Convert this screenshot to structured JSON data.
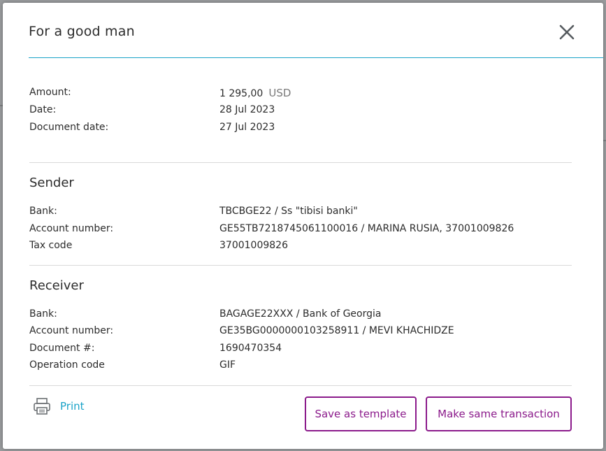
{
  "modal": {
    "title": "For a good man"
  },
  "summary": {
    "amount_label": "Amount:",
    "amount_value": "1 295,00",
    "amount_currency": "USD",
    "date_label": "Date:",
    "date_value": "28 Jul 2023",
    "document_date_label": "Document date:",
    "document_date_value": "27 Jul 2023"
  },
  "sender": {
    "title": "Sender",
    "bank_label": "Bank:",
    "bank_value": "TBCBGE22 / Ss \"tibisi banki\"",
    "account_label": "Account number:",
    "account_value": "GE55TB7218745061100016 / MARINA RUSIA, 37001009826",
    "tax_label": "Tax code",
    "tax_value": "37001009826"
  },
  "receiver": {
    "title": "Receiver",
    "bank_label": "Bank:",
    "bank_value": "BAGAGE22XXX / Bank of Georgia",
    "account_label": "Account number:",
    "account_value": "GE35BG0000000103258911 / MEVI KHACHIDZE",
    "document_label": "Document #:",
    "document_value": "1690470354",
    "operation_label": "Operation code",
    "operation_value": "GIF"
  },
  "footer": {
    "print_label": "Print",
    "save_template_label": "Save as template",
    "same_transaction_label": "Make same transaction"
  },
  "icons": {
    "close": "close-icon",
    "print": "printer-icon"
  },
  "colors": {
    "accent": "#1aa3c8",
    "brand": "#8b1a8b"
  }
}
